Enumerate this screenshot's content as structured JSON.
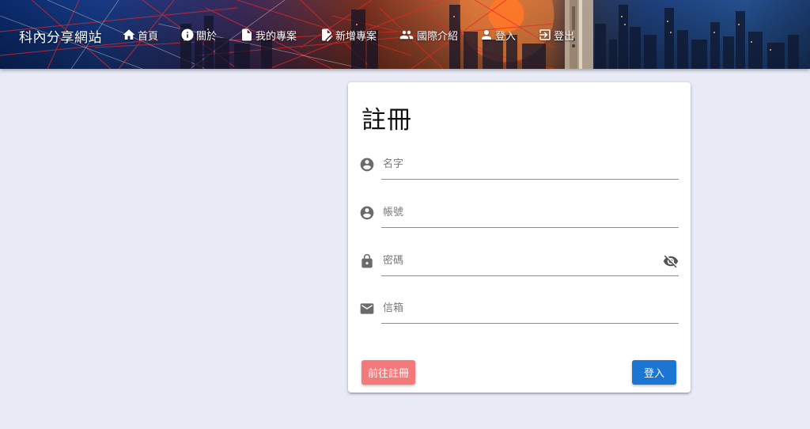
{
  "header": {
    "brand": "科內分享網站",
    "nav": [
      {
        "label": "首頁",
        "icon": "home-icon"
      },
      {
        "label": "關於",
        "icon": "info-icon"
      },
      {
        "label": "我的專案",
        "icon": "document-icon"
      },
      {
        "label": "新增專案",
        "icon": "document-edit-icon"
      },
      {
        "label": "國際介紹",
        "icon": "people-icon"
      },
      {
        "label": "登入",
        "icon": "person-icon"
      },
      {
        "label": "登出",
        "icon": "logout-icon"
      }
    ]
  },
  "form": {
    "title": "註冊",
    "fields": {
      "name": {
        "placeholder": "名字",
        "icon": "account-circle-icon",
        "value": ""
      },
      "account": {
        "placeholder": "帳號",
        "icon": "account-circle-icon",
        "value": ""
      },
      "password": {
        "placeholder": "密碼",
        "icon": "lock-icon",
        "value": "",
        "toggle_icon": "visibility-off-icon"
      },
      "email": {
        "placeholder": "信箱",
        "icon": "mail-icon",
        "value": ""
      }
    },
    "register_button": "前往註冊",
    "login_button": "登入"
  },
  "colors": {
    "page_background": "#e8eaf5",
    "register_button": "#f3797b",
    "login_button": "#1a76d2"
  }
}
